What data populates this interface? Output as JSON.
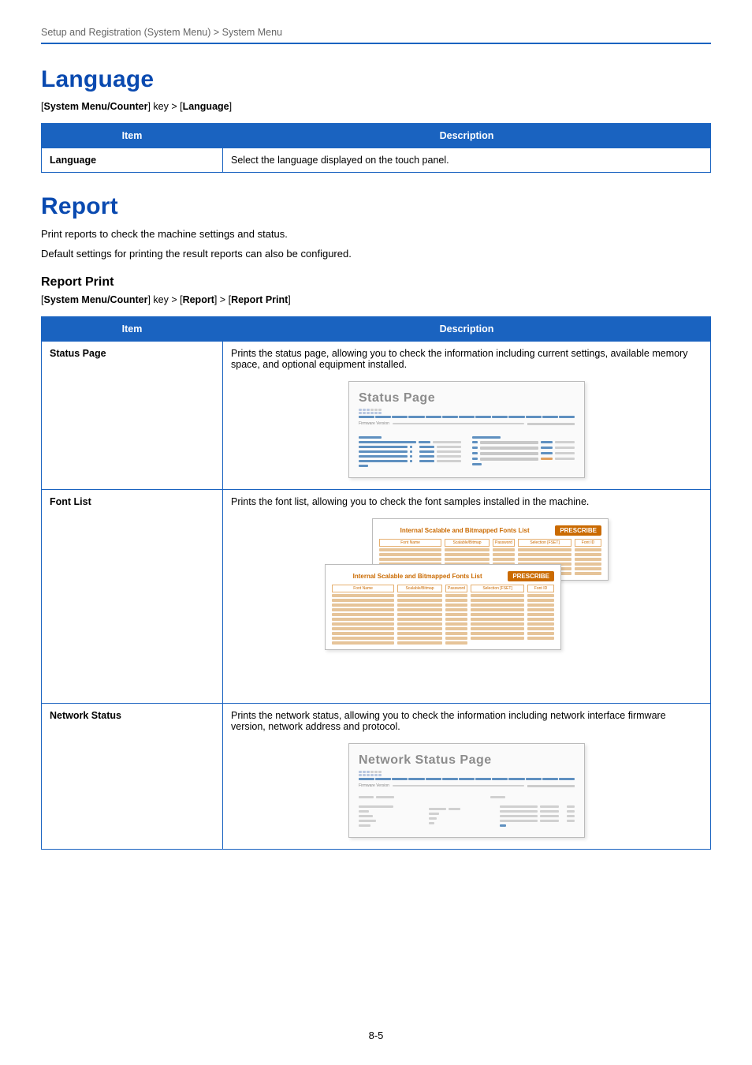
{
  "breadcrumb": "Setup and Registration (System Menu) > System Menu",
  "language_section": {
    "heading": "Language",
    "nav_prefix": "[",
    "nav_key1": "System Menu/Counter",
    "nav_mid": "] key > [",
    "nav_key2": "Language",
    "nav_suffix": "]",
    "table": {
      "col_item": "Item",
      "col_desc": "Description",
      "row_item": "Language",
      "row_desc": "Select the language displayed on the touch panel."
    }
  },
  "report_section": {
    "heading": "Report",
    "p1": "Print reports to check the machine settings and status.",
    "p2": "Default settings for printing the result reports can also be configured.",
    "sub_heading": "Report Print",
    "nav_key1": "System Menu/Counter",
    "nav_mid1": "] key > [",
    "nav_key2": "Report",
    "nav_mid2": "] > [",
    "nav_key3": "Report Print",
    "table": {
      "col_item": "Item",
      "col_desc": "Description",
      "rows": {
        "status": {
          "item": "Status Page",
          "desc": "Prints the status page, allowing you to check the information including current settings, available memory space, and optional equipment installed.",
          "thumb_title": "Status Page",
          "thumb_fw": "Firmware Version"
        },
        "font": {
          "item": "Font List",
          "desc": "Prints the font list, allowing you to check the font samples installed in the machine.",
          "card_title": "Internal Scalable and Bitmapped Fonts List",
          "tag": "PRESCRIBE",
          "ch1": "Font Name",
          "ch2": "Scalable/Bitmap",
          "ch3": "Password",
          "ch4": "Selection      [FSET]",
          "ch5": "Font ID"
        },
        "network": {
          "item": "Network Status",
          "desc": "Prints the network status, allowing you to check the information including network interface firmware version, network address and protocol.",
          "thumb_title": "Network Status Page",
          "thumb_fw": "Firmware Version"
        }
      }
    }
  },
  "page_num": "8-5"
}
